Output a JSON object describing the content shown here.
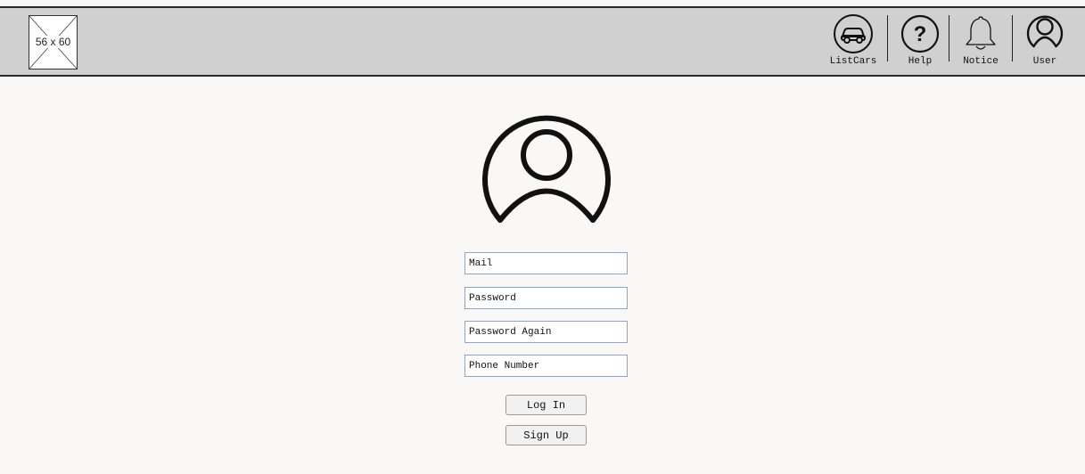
{
  "header": {
    "logo_text": "56 x 60",
    "nav": [
      {
        "label": "ListCars",
        "icon": "car-icon"
      },
      {
        "label": "Help",
        "icon": "question-icon"
      },
      {
        "label": "Notice",
        "icon": "bell-icon"
      },
      {
        "label": "User",
        "icon": "user-icon"
      }
    ]
  },
  "form": {
    "avatar_icon": "user-avatar-icon",
    "mail_placeholder": "Mail",
    "password_placeholder": "Password",
    "password_again_placeholder": "Password Again",
    "phone_placeholder": "Phone Number",
    "login_label": "Log In",
    "signup_label": "Sign Up"
  },
  "colors": {
    "header_bg": "#d0d0d0",
    "page_bg": "#f9f8f6",
    "field_border": "#8fa5c8"
  }
}
